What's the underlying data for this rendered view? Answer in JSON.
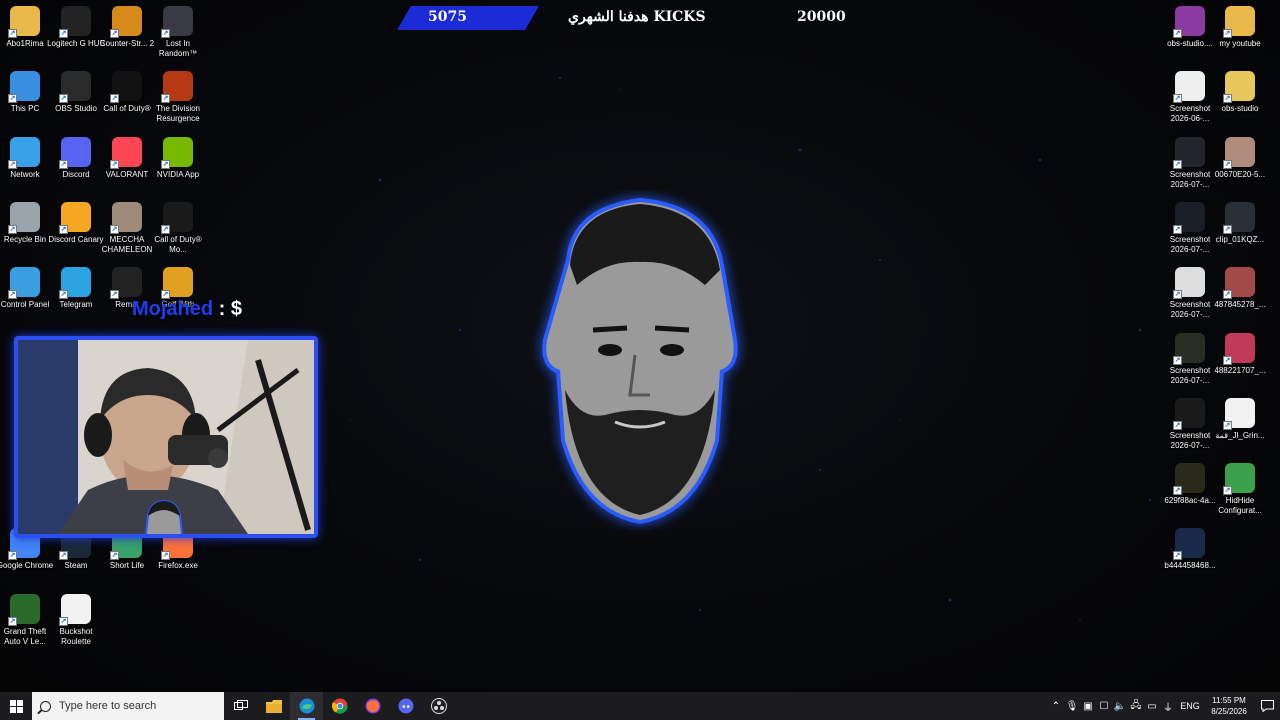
{
  "stream": {
    "goal_current": "5075",
    "goal_title": "هدفنا الشهري KICKS",
    "goal_target": "20000",
    "chat_user": "Mojahed",
    "chat_separator": " : ",
    "chat_message": "$"
  },
  "desktop_left": [
    {
      "label": "Abo1Rima",
      "icon": "folder-icon",
      "color": "#e8b84a"
    },
    {
      "label": "Logitech G HUB",
      "icon": "logitech-g-icon",
      "color": "#222222"
    },
    {
      "label": "Counter-Str... 2",
      "icon": "counter-strike-icon",
      "color": "#d58a1a"
    },
    {
      "label": "Lost In Random™",
      "icon": "lost-in-random-icon",
      "color": "#3a3a44"
    },
    {
      "label": "This PC",
      "icon": "computer-icon",
      "color": "#3a8fe0"
    },
    {
      "label": "OBS Studio",
      "icon": "obs-icon",
      "color": "#2a2a2a"
    },
    {
      "label": "Call of Duty®",
      "icon": "call-of-duty-icon",
      "color": "#111111"
    },
    {
      "label": "The Division Resurgence",
      "icon": "division-icon",
      "color": "#b33a12"
    },
    {
      "label": "Network",
      "icon": "network-icon",
      "color": "#3aa0e8"
    },
    {
      "label": "Discord",
      "icon": "discord-icon",
      "color": "#5865f2"
    },
    {
      "label": "VALORANT",
      "icon": "valorant-icon",
      "color": "#ff4655"
    },
    {
      "label": "NVIDIA App",
      "icon": "nvidia-icon",
      "color": "#76b900"
    },
    {
      "label": "Recycle Bin",
      "icon": "recycle-bin-icon",
      "color": "#9aa4ad"
    },
    {
      "label": "Discord Canary",
      "icon": "discord-canary-icon",
      "color": "#f5a623"
    },
    {
      "label": "MECCHA CHAMELEON",
      "icon": "meccha-icon",
      "color": "#a08a7a"
    },
    {
      "label": "Call of Duty® Mo...",
      "icon": "mw3-icon",
      "color": "#1a1a1a"
    },
    {
      "label": "Control Panel",
      "icon": "control-panel-icon",
      "color": "#3a9ee0"
    },
    {
      "label": "Telegram",
      "icon": "telegram-icon",
      "color": "#2aa3e0"
    },
    {
      "label": "Remat",
      "icon": "rematch-icon",
      "color": "#222222"
    },
    {
      "label": "Golf With",
      "icon": "golf-with-friends-icon",
      "color": "#e0a020"
    },
    {
      "label": "Google Chrome",
      "icon": "chrome-icon",
      "color": "#4285f4"
    },
    {
      "label": "Steam",
      "icon": "steam-icon",
      "color": "#1b2838"
    },
    {
      "label": "Short Life",
      "icon": "short-life-icon",
      "color": "#3aa06a"
    },
    {
      "label": "Firefox.exe",
      "icon": "firefox-icon",
      "color": "#ff7139"
    },
    {
      "label": "Grand Theft Auto V Le...",
      "icon": "gta-icon",
      "color": "#2a6a2a"
    },
    {
      "label": "Buckshot Roulette",
      "icon": "file-icon",
      "color": "#f2f2f2"
    }
  ],
  "desktop_right": [
    {
      "label": "obs-studio....",
      "icon": "winrar-icon",
      "color": "#8a3aa0"
    },
    {
      "label": "my youtube",
      "icon": "folder-icon",
      "color": "#e8b84a"
    },
    {
      "label": "Screenshot 2026-06-...",
      "icon": "screenshot-thumb-icon",
      "color": "#eeeeee"
    },
    {
      "label": "obs-studio",
      "icon": "folder-icon",
      "color": "#e8c85a"
    },
    {
      "label": "Screenshot 2026-07-...",
      "icon": "screenshot-thumb-icon",
      "color": "#22262c"
    },
    {
      "label": "00670E20-5...",
      "icon": "photo-thumb-icon",
      "color": "#b08a7a"
    },
    {
      "label": "Screenshot 2026-07-...",
      "icon": "screenshot-thumb-icon",
      "color": "#1a1e26"
    },
    {
      "label": "clip_01KQZ...",
      "icon": "video-thumb-icon",
      "color": "#2a2e36"
    },
    {
      "label": "Screenshot 2026-07-...",
      "icon": "screenshot-thumb-icon",
      "color": "#dddddd"
    },
    {
      "label": "487845278_...",
      "icon": "photo-thumb-icon",
      "color": "#a04a4a"
    },
    {
      "label": "Screenshot 2026-07-...",
      "icon": "screenshot-thumb-icon",
      "color": "#2a2e22"
    },
    {
      "label": "488221707_...",
      "icon": "photo-thumb-icon",
      "color": "#c03a5a"
    },
    {
      "label": "Screenshot 2026-07-...",
      "icon": "screenshot-thumb-icon",
      "color": "#1a1a1a"
    },
    {
      "label": "قمة_Jl_Grin...",
      "icon": "media-play-icon",
      "color": "#f2f2f2"
    },
    {
      "label": "629f88ac-4a...",
      "icon": "photo-thumb-icon",
      "color": "#2a2a1a"
    },
    {
      "label": "HidHide Configurat...",
      "icon": "hidhide-icon",
      "color": "#3aa04a"
    },
    {
      "label": "b444458468...",
      "icon": "photo-thumb-icon",
      "color": "#1a2a4a"
    }
  ],
  "taskbar": {
    "search_placeholder": "Type here to search",
    "language": "ENG",
    "time": "11:55 PM",
    "date": "8/25/2026"
  },
  "colors": {
    "accent": "#1b2bd6",
    "glow": "#2b4ff0",
    "taskbar": "#1c1c1f"
  }
}
